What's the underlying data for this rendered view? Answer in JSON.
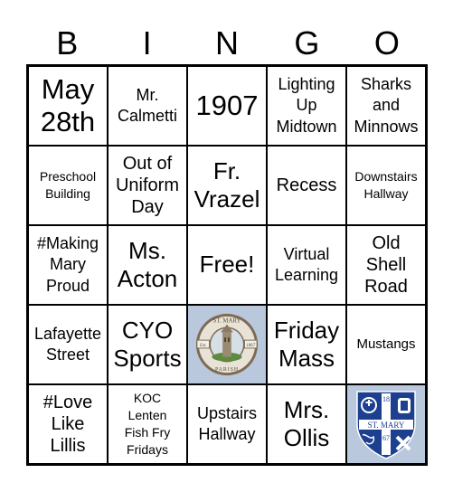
{
  "header": {
    "letters": [
      "B",
      "I",
      "N",
      "G",
      "O"
    ]
  },
  "board": {
    "rows": [
      [
        {
          "text": "May\n28th"
        },
        {
          "text": "Mr.\nCalmetti"
        },
        {
          "text": "1907"
        },
        {
          "text": "Lighting\nUp\nMidtown"
        },
        {
          "text": "Sharks\nand\nMinnows"
        }
      ],
      [
        {
          "text": "Preschool\nBuilding"
        },
        {
          "text": "Out of\nUniform\nDay"
        },
        {
          "text": "Fr.\nVrazel"
        },
        {
          "text": "Recess"
        },
        {
          "text": "Downstairs\nHallway"
        }
      ],
      [
        {
          "text": "#Making\nMary\nProud"
        },
        {
          "text": "Ms.\nActon"
        },
        {
          "text": "Free!"
        },
        {
          "text": "Virtual\nLearning"
        },
        {
          "text": "Old\nShell\nRoad"
        }
      ],
      [
        {
          "text": "Lafayette\nStreet"
        },
        {
          "text": "CYO\nSports"
        },
        {
          "image": "st-mary-parish-seal",
          "seal_top": "ST. MARY",
          "seal_bottom": "PARISH",
          "seal_left": "Est.",
          "seal_right": "1867"
        },
        {
          "text": "Friday\nMass"
        },
        {
          "text": "Mustangs"
        }
      ],
      [
        {
          "text": "#Love\nLike\nLillis"
        },
        {
          "text": "KOC\nLenten\nFish Fry\nFridays"
        },
        {
          "text": "Upstairs\nHallway"
        },
        {
          "text": "Mrs.\nOllis"
        },
        {
          "image": "st-mary-school-crest",
          "crest_text": "ST. MARY",
          "crest_year_top": "18",
          "crest_year_bottom": "67"
        }
      ]
    ]
  },
  "colors": {
    "image_bg": "#b9c8dd",
    "crest_blue": "#1d3f8f",
    "seal_ring": "#e8e3d6"
  }
}
